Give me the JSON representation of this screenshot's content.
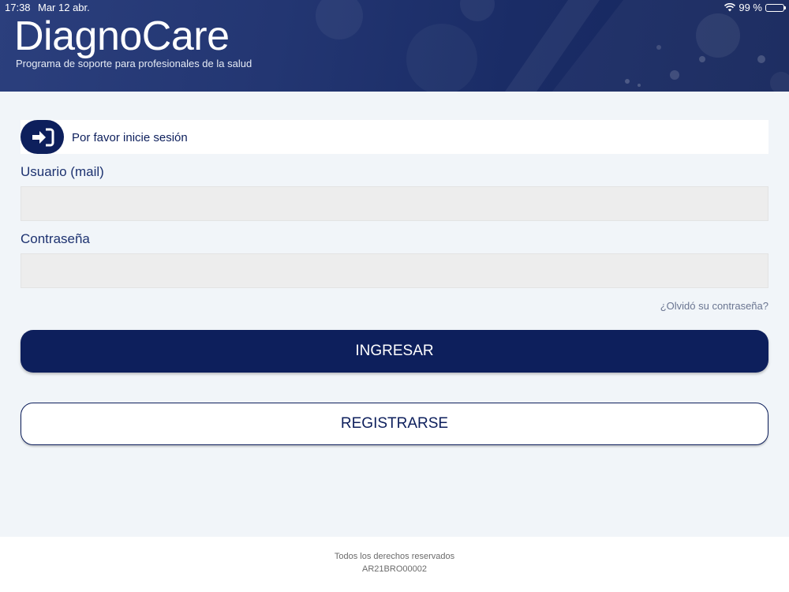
{
  "status_bar": {
    "time": "17:38",
    "date": "Mar 12 abr.",
    "battery": "99 %"
  },
  "header": {
    "brand": "DiagnoCare",
    "tagline": "Programa de soporte para profesionales de la salud"
  },
  "notice": {
    "text": "Por favor inicie sesión",
    "icon": "login-icon"
  },
  "form": {
    "username_label": "Usuario (mail)",
    "username_value": "",
    "password_label": "Contraseña",
    "password_value": "",
    "forgot_link": "¿Olvidó su contraseña?"
  },
  "buttons": {
    "login": "INGRESAR",
    "register": "REGISTRARSE"
  },
  "footer": {
    "rights": "Todos los derechos reservados",
    "code": "AR21BRO00002"
  },
  "colors": {
    "primary": "#0d1f5c",
    "background": "#f1f5f9",
    "field": "#ededed"
  }
}
